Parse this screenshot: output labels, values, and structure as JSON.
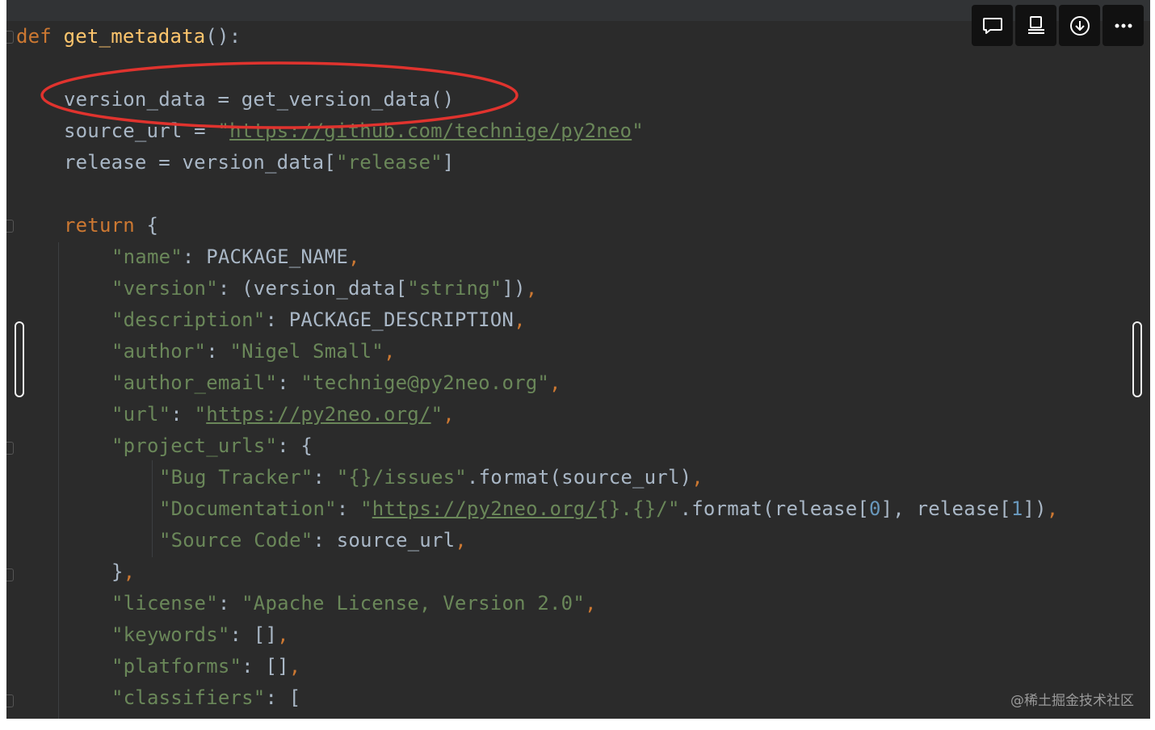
{
  "toolbar": {
    "buttons": [
      {
        "icon": "comment-icon"
      },
      {
        "icon": "screen-share-icon"
      },
      {
        "icon": "download-icon"
      },
      {
        "icon": "more-icon"
      }
    ]
  },
  "watermark": "@稀土掘金技术社区",
  "colors": {
    "background": "#2b2b2b",
    "keyword": "#cc7832",
    "function": "#ffc66d",
    "string": "#6a8759",
    "number": "#6897bb",
    "text": "#a9b7c6",
    "annotation": "#e0332e"
  },
  "code": {
    "def_keyword": "def",
    "func_name": "get_metadata",
    "func_sig_tail": "():",
    "l2_a": "version_data = get_version_data()",
    "l3_a": "source_url = ",
    "l3_q1": "\"",
    "l3_url": "https://github.com/technige/py2neo",
    "l3_q2": "\"",
    "l4_a": "release = version_data[",
    "l4_s": "\"release\"",
    "l4_b": "]",
    "l5_kw": "return",
    "l5_b": " {",
    "l6_s": "\"name\"",
    "l6_a": ": PACKAGE_NAME",
    "l6_c": ",",
    "l7_s": "\"version\"",
    "l7_a": ": (version_data[",
    "l7_s2": "\"string\"",
    "l7_b": "])",
    "l7_c": ",",
    "l8_s": "\"description\"",
    "l8_a": ": PACKAGE_DESCRIPTION",
    "l8_c": ",",
    "l9_s": "\"author\"",
    "l9_a": ": ",
    "l9_s2": "\"Nigel Small\"",
    "l9_c": ",",
    "l10_s": "\"author_email\"",
    "l10_a": ": ",
    "l10_s2": "\"technige@py2neo.org\"",
    "l10_c": ",",
    "l11_s": "\"url\"",
    "l11_a": ": ",
    "l11_q1": "\"",
    "l11_url": "https://py2neo.org/",
    "l11_q2": "\"",
    "l11_c": ",",
    "l12_s": "\"project_urls\"",
    "l12_a": ": {",
    "l13_s": "\"Bug Tracker\"",
    "l13_a": ": ",
    "l13_s2": "\"{}/issues\"",
    "l13_b": ".format(source_url)",
    "l13_c": ",",
    "l14_s": "\"Documentation\"",
    "l14_a": ": ",
    "l14_q1": "\"",
    "l14_url": "https://py2neo.org/",
    "l14_s2": "{}.{}/\"",
    "l14_b": ".format(release[",
    "l14_n1": "0",
    "l14_c1": "], release[",
    "l14_n2": "1",
    "l14_d": "])",
    "l14_e": ",",
    "l15_s": "\"Source Code\"",
    "l15_a": ": source_url",
    "l15_c": ",",
    "l16_a": "}",
    "l16_c": ",",
    "l17_s": "\"license\"",
    "l17_a": ": ",
    "l17_s2": "\"Apache License, Version 2.0\"",
    "l17_c": ",",
    "l18_s": "\"keywords\"",
    "l18_a": ": []",
    "l18_c": ",",
    "l19_s": "\"platforms\"",
    "l19_a": ": []",
    "l19_c": ",",
    "l20_s": "\"classifiers\"",
    "l20_a": ": ["
  }
}
